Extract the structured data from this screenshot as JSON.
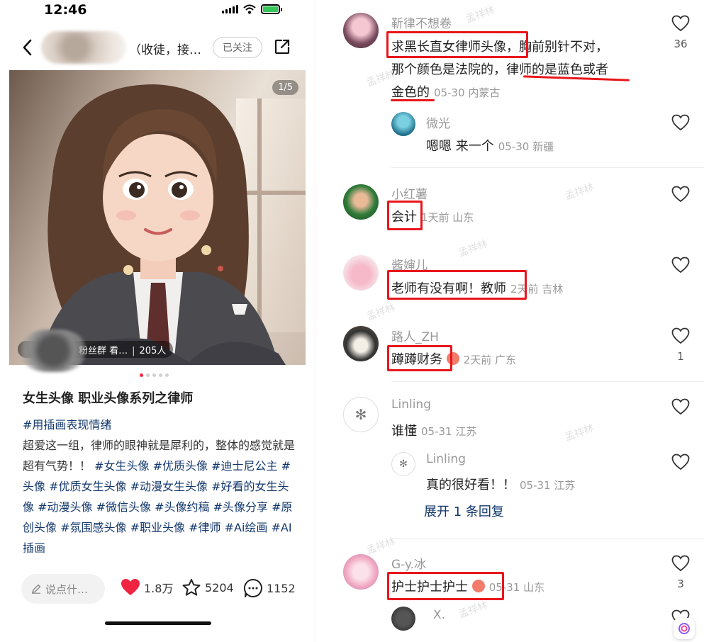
{
  "status": {
    "time": "12:46"
  },
  "nav": {
    "author_suffix": "（收徒，接…",
    "follow_label": "已关注"
  },
  "cover": {
    "page_indicator": "1/5",
    "fan_group": "粉丝群 看…",
    "fan_count": "205人"
  },
  "note": {
    "title": "女生头像 职业头像系列之律师",
    "first_tag": "#用插画表现情绪",
    "body": "超爱这一组，律师的眼神就是犀利的，整体的感觉就是超有气势！！",
    "tags": [
      "#女生头像",
      "#优质头像",
      "#迪士尼公主",
      "#头像",
      "#优质女生头像",
      "#动漫女生头像",
      "#好看的女生头像",
      "#动漫头像",
      "#微信头像",
      "#头像约稿",
      "#头像分享",
      "#原创头像",
      "#氛围感头像",
      "#职业头像",
      "#律师",
      "#Ai绘画",
      "#AI插画"
    ]
  },
  "bottom": {
    "comment_placeholder": "说点什…",
    "likes": "1.8万",
    "collects": "5204",
    "comments": "1152"
  },
  "comments": [
    {
      "user": "靳律不想卷",
      "text_a": "求黑长直女律师头像",
      "text_b": "，胸前别针不对，",
      "line2_a": "那个颜色是法院的，",
      "line2_b": "律师的是蓝色或者",
      "line3_a": "金色的",
      "meta": "05-30 内蒙古",
      "likes": "36"
    },
    {
      "user": "微光",
      "text": "嗯嗯 来一个",
      "meta": "05-30 新疆",
      "likes": ""
    },
    {
      "user": "小红薯",
      "text": "会计",
      "meta": "1天前 山东",
      "likes": ""
    },
    {
      "user": "酱婶儿",
      "text": "老师有没有啊！教师",
      "meta": "2天前 吉林",
      "likes": ""
    },
    {
      "user": "路人_ZH",
      "text": "蹲蹲财务",
      "meta": "2天前 广东",
      "likes": "1"
    },
    {
      "user": "Linling",
      "text": "谁懂",
      "meta": "05-31 江苏",
      "likes": ""
    },
    {
      "user": "Linling",
      "text": "真的很好看！！",
      "meta": "05-31 江苏",
      "likes": ""
    },
    {
      "user": "G-y.冰",
      "text": "护士护士护士",
      "meta": "05-31 山东",
      "likes": "3"
    },
    {
      "user": "X.",
      "text": "",
      "meta": "",
      "likes": ""
    }
  ],
  "expand_label": "展开 1 条回复",
  "watermark": "孟祥林"
}
